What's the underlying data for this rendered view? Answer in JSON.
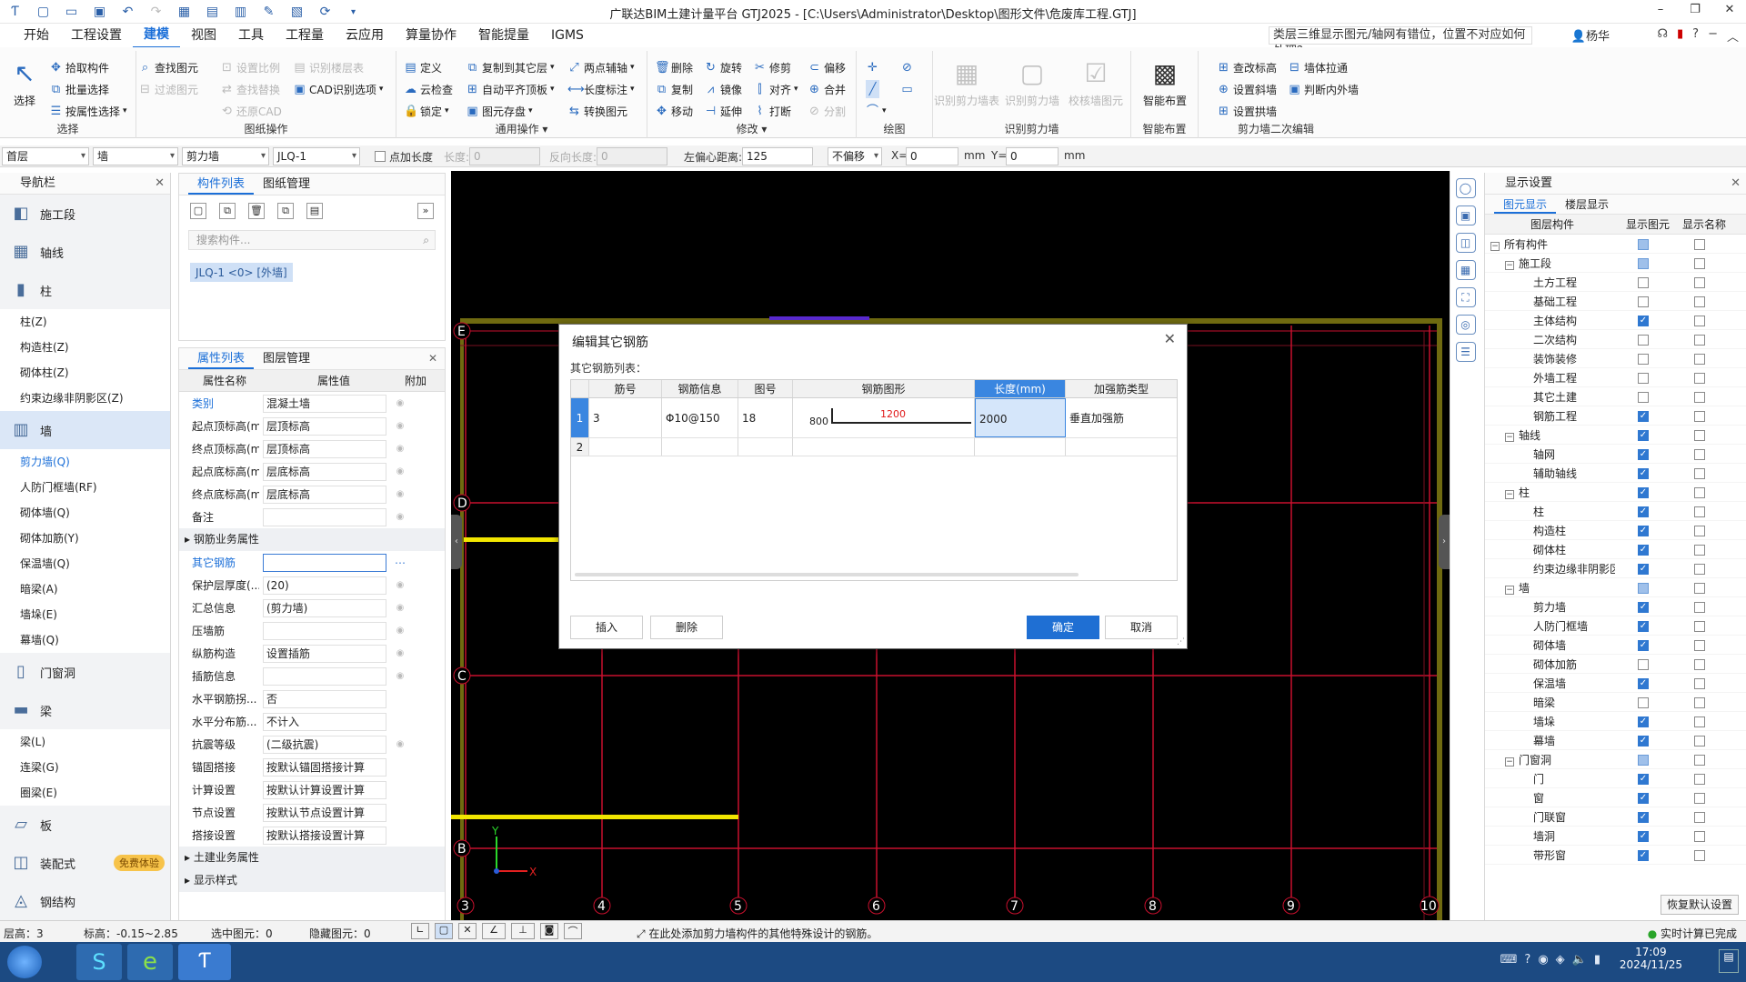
{
  "window": {
    "title": "广联达BIM土建计量平台 GTJ2025 - [C:\\Users\\Administrator\\Desktop\\图形文件\\危废库工程.GTJ]"
  },
  "menu": [
    "开始",
    "工程设置",
    "建模",
    "视图",
    "工具",
    "工程量",
    "云应用",
    "算量协作",
    "智能提量",
    "IGMS"
  ],
  "help_box": "类层三维显示图元/轴网有错位，位置不对应如何处理？",
  "user": "杨华",
  "ribbon": {
    "select_big": "选择",
    "select_items": [
      "拾取构件",
      "批量选择",
      "按属性选择"
    ],
    "select_title": "选择",
    "drawing_items": [
      "查找图元",
      "过滤图元",
      "设置比例",
      "还原CAD",
      "识别楼层表",
      "CAD识别选项",
      "查找替换"
    ],
    "drawing_title": "图纸操作",
    "common_items": [
      "定义",
      "云检查",
      "锁定",
      "复制到其它层",
      "自动平齐顶板",
      "图元存盘",
      "两点辅轴",
      "长度标注",
      "转换图元"
    ],
    "common_title": "通用操作",
    "modify_items": [
      "删除",
      "复制",
      "移动",
      "旋转",
      "镜像",
      "延伸",
      "修剪",
      "对齐",
      "打断",
      "偏移",
      "合并",
      "分割"
    ],
    "modify_title": "修改",
    "draw_title": "绘图",
    "recognize_big": [
      "识别剪力墙表",
      "识别剪力墙",
      "校核墙图元"
    ],
    "recognize_title": "识别剪力墙",
    "smart_big": "智能布置",
    "smart_title": "智能布置",
    "edit2_items": [
      "查改标高",
      "设置斜墙",
      "设置拱墙",
      "墙体拉通",
      "判断内外墙"
    ],
    "edit2_title": "剪力墙二次编辑"
  },
  "propbar": {
    "floor": "首层",
    "type": "墙",
    "subtype": "剪力墙",
    "comp": "JLQ-1",
    "add_len": "点加长度",
    "len_lbl": "长度:",
    "len_val": "0",
    "rev_lbl": "反向长度:",
    "rev_val": "0",
    "offset_lbl": "左偏心距离:",
    "offset_val": "125",
    "no_offset": "不偏移",
    "x_lbl": "X=",
    "x_val": "0",
    "y_lbl": "Y=",
    "y_val": "0",
    "unit": "mm"
  },
  "nav": {
    "title": "导航栏",
    "items": [
      {
        "t": "cat",
        "label": "施工段",
        "icon": "◧"
      },
      {
        "t": "cat",
        "label": "轴线",
        "icon": "▦"
      },
      {
        "t": "cat",
        "label": "柱",
        "icon": "▮"
      },
      {
        "t": "sub",
        "label": "柱(Z)"
      },
      {
        "t": "sub",
        "label": "构造柱(Z)"
      },
      {
        "t": "sub",
        "label": "砌体柱(Z)"
      },
      {
        "t": "sub",
        "label": "约束边缘非阴影区(Z)"
      },
      {
        "t": "cat",
        "label": "墙",
        "icon": "▥",
        "active": true
      },
      {
        "t": "sub",
        "label": "剪力墙(Q)",
        "active": true
      },
      {
        "t": "sub",
        "label": "人防门框墙(RF)"
      },
      {
        "t": "sub",
        "label": "砌体墙(Q)"
      },
      {
        "t": "sub",
        "label": "砌体加筋(Y)"
      },
      {
        "t": "sub",
        "label": "保温墙(Q)"
      },
      {
        "t": "sub",
        "label": "暗梁(A)"
      },
      {
        "t": "sub",
        "label": "墙垛(E)"
      },
      {
        "t": "sub",
        "label": "幕墙(Q)"
      },
      {
        "t": "cat",
        "label": "门窗洞",
        "icon": "▯"
      },
      {
        "t": "cat",
        "label": "梁",
        "icon": "▬"
      },
      {
        "t": "sub",
        "label": "梁(L)"
      },
      {
        "t": "sub",
        "label": "连梁(G)"
      },
      {
        "t": "sub",
        "label": "圈梁(E)"
      },
      {
        "t": "cat",
        "label": "板",
        "icon": "▱"
      },
      {
        "t": "cat",
        "label": "装配式",
        "icon": "◫",
        "badge": "免费体验"
      },
      {
        "t": "cat",
        "label": "钢结构",
        "icon": "◬"
      }
    ]
  },
  "comp_panel": {
    "tabs": [
      "构件列表",
      "图纸管理"
    ],
    "search": "搜索构件...",
    "item": "JLQ-1 <0> [外墙]"
  },
  "prop_panel": {
    "tabs": [
      "属性列表",
      "图层管理"
    ],
    "headers": [
      "属性名称",
      "属性值",
      "附加"
    ],
    "rows": [
      {
        "n": "类别",
        "v": "混凝土墙",
        "blue": true,
        "a": true
      },
      {
        "n": "起点顶标高(m)",
        "v": "层顶标高",
        "a": true
      },
      {
        "n": "终点顶标高(m)",
        "v": "层顶标高",
        "a": true
      },
      {
        "n": "起点底标高(m)",
        "v": "层底标高",
        "a": true
      },
      {
        "n": "终点底标高(m)",
        "v": "层底标高",
        "a": true
      },
      {
        "n": "备注",
        "v": "",
        "a": true
      },
      {
        "sec": "钢筋业务属性"
      },
      {
        "n": "其它钢筋",
        "v": "",
        "blue": true,
        "sel": true
      },
      {
        "n": "保护层厚度(...",
        "v": "(20)",
        "a": true
      },
      {
        "n": "汇总信息",
        "v": "(剪力墙)",
        "a": true
      },
      {
        "n": "压墙筋",
        "v": "",
        "a": true
      },
      {
        "n": "纵筋构造",
        "v": "设置插筋",
        "a": true
      },
      {
        "n": "插筋信息",
        "v": "",
        "a": true
      },
      {
        "n": "水平钢筋拐...",
        "v": "否"
      },
      {
        "n": "水平分布筋...",
        "v": "不计入"
      },
      {
        "n": "抗震等级",
        "v": "(二级抗震)",
        "a": true
      },
      {
        "n": "锚固搭接",
        "v": "按默认锚固搭接计算"
      },
      {
        "n": "计算设置",
        "v": "按默认计算设置计算"
      },
      {
        "n": "节点设置",
        "v": "按默认节点设置计算"
      },
      {
        "n": "搭接设置",
        "v": "按默认搭接设置计算"
      },
      {
        "sec": "土建业务属性"
      },
      {
        "sec": "显示样式"
      }
    ]
  },
  "grid": {
    "rows": [
      "E",
      "D",
      "C",
      "B"
    ],
    "cols": [
      "3",
      "4",
      "5",
      "6",
      "7",
      "8",
      "9",
      "10"
    ]
  },
  "axes": {
    "x": "X",
    "y": "Y"
  },
  "dialog": {
    "title": "编辑其它钢筋",
    "sub": "其它钢筋列表：",
    "headers": [
      "筋号",
      "钢筋信息",
      "图号",
      "钢筋图形",
      "长度(mm)",
      "加强筋类型"
    ],
    "rows": [
      {
        "no": "1",
        "id": "3",
        "info": "Φ10@150",
        "fig": "18",
        "dim1": "800",
        "dim2": "1200",
        "len": "2000",
        "type": "垂直加强筋"
      },
      {
        "no": "2"
      }
    ],
    "buttons": [
      "插入",
      "删除",
      "确定",
      "取消"
    ]
  },
  "display": {
    "title": "显示设置",
    "tabs": [
      "图元显示",
      "楼层显示"
    ],
    "headers": [
      "图层构件",
      "显示图元",
      "显示名称"
    ],
    "rows": [
      {
        "n": "所有构件",
        "l": 0,
        "tog": "−",
        "a": "part",
        "b": "off"
      },
      {
        "n": "施工段",
        "l": 1,
        "tog": "−",
        "a": "part",
        "b": "off"
      },
      {
        "n": "土方工程",
        "l": 2,
        "a": "off",
        "b": "off"
      },
      {
        "n": "基础工程",
        "l": 2,
        "a": "off",
        "b": "off"
      },
      {
        "n": "主体结构",
        "l": 2,
        "a": "on",
        "b": "off"
      },
      {
        "n": "二次结构",
        "l": 2,
        "a": "off",
        "b": "off"
      },
      {
        "n": "装饰装修",
        "l": 2,
        "a": "off",
        "b": "off"
      },
      {
        "n": "外墙工程",
        "l": 2,
        "a": "off",
        "b": "off"
      },
      {
        "n": "其它土建",
        "l": 2,
        "a": "off",
        "b": "off"
      },
      {
        "n": "钢筋工程",
        "l": 2,
        "a": "on",
        "b": "off"
      },
      {
        "n": "轴线",
        "l": 1,
        "tog": "−",
        "a": "on",
        "b": "off"
      },
      {
        "n": "轴网",
        "l": 2,
        "a": "on",
        "b": "off"
      },
      {
        "n": "辅助轴线",
        "l": 2,
        "a": "on",
        "b": "off"
      },
      {
        "n": "柱",
        "l": 1,
        "tog": "−",
        "a": "on",
        "b": "off"
      },
      {
        "n": "柱",
        "l": 2,
        "a": "on",
        "b": "off"
      },
      {
        "n": "构造柱",
        "l": 2,
        "a": "on",
        "b": "off"
      },
      {
        "n": "砌体柱",
        "l": 2,
        "a": "on",
        "b": "off"
      },
      {
        "n": "约束边缘非阴影区",
        "l": 2,
        "a": "on",
        "b": "off"
      },
      {
        "n": "墙",
        "l": 1,
        "tog": "−",
        "a": "part",
        "b": "off"
      },
      {
        "n": "剪力墙",
        "l": 2,
        "a": "on",
        "b": "off"
      },
      {
        "n": "人防门框墙",
        "l": 2,
        "a": "on",
        "b": "off"
      },
      {
        "n": "砌体墙",
        "l": 2,
        "a": "on",
        "b": "off"
      },
      {
        "n": "砌体加筋",
        "l": 2,
        "a": "off",
        "b": "off"
      },
      {
        "n": "保温墙",
        "l": 2,
        "a": "on",
        "b": "off"
      },
      {
        "n": "暗梁",
        "l": 2,
        "a": "off",
        "b": "off"
      },
      {
        "n": "墙垛",
        "l": 2,
        "a": "on",
        "b": "off"
      },
      {
        "n": "幕墙",
        "l": 2,
        "a": "on",
        "b": "off"
      },
      {
        "n": "门窗洞",
        "l": 1,
        "tog": "−",
        "a": "part",
        "b": "off"
      },
      {
        "n": "门",
        "l": 2,
        "a": "on",
        "b": "off"
      },
      {
        "n": "窗",
        "l": 2,
        "a": "on",
        "b": "off"
      },
      {
        "n": "门联窗",
        "l": 2,
        "a": "on",
        "b": "off"
      },
      {
        "n": "墙洞",
        "l": 2,
        "a": "on",
        "b": "off"
      },
      {
        "n": "带形窗",
        "l": 2,
        "a": "on",
        "b": "off"
      }
    ],
    "restore": "恢复默认设置"
  },
  "status": {
    "floor": "层高：3",
    "elev": "标高：-0.15~2.85",
    "selected": "选中图元：0",
    "hidden": "隐藏图元：0",
    "hint": "在此处添加剪力墙构件的其他特殊设计的钢筋。",
    "calc": "实时计算已完成"
  },
  "taskbar": {
    "time": "17:09",
    "date": "2024/11/25"
  },
  "colors": {
    "accent": "#1b6fd8",
    "grid_line": "#c8102e",
    "wall": "#6f6a10",
    "beam": "#f2e600"
  }
}
